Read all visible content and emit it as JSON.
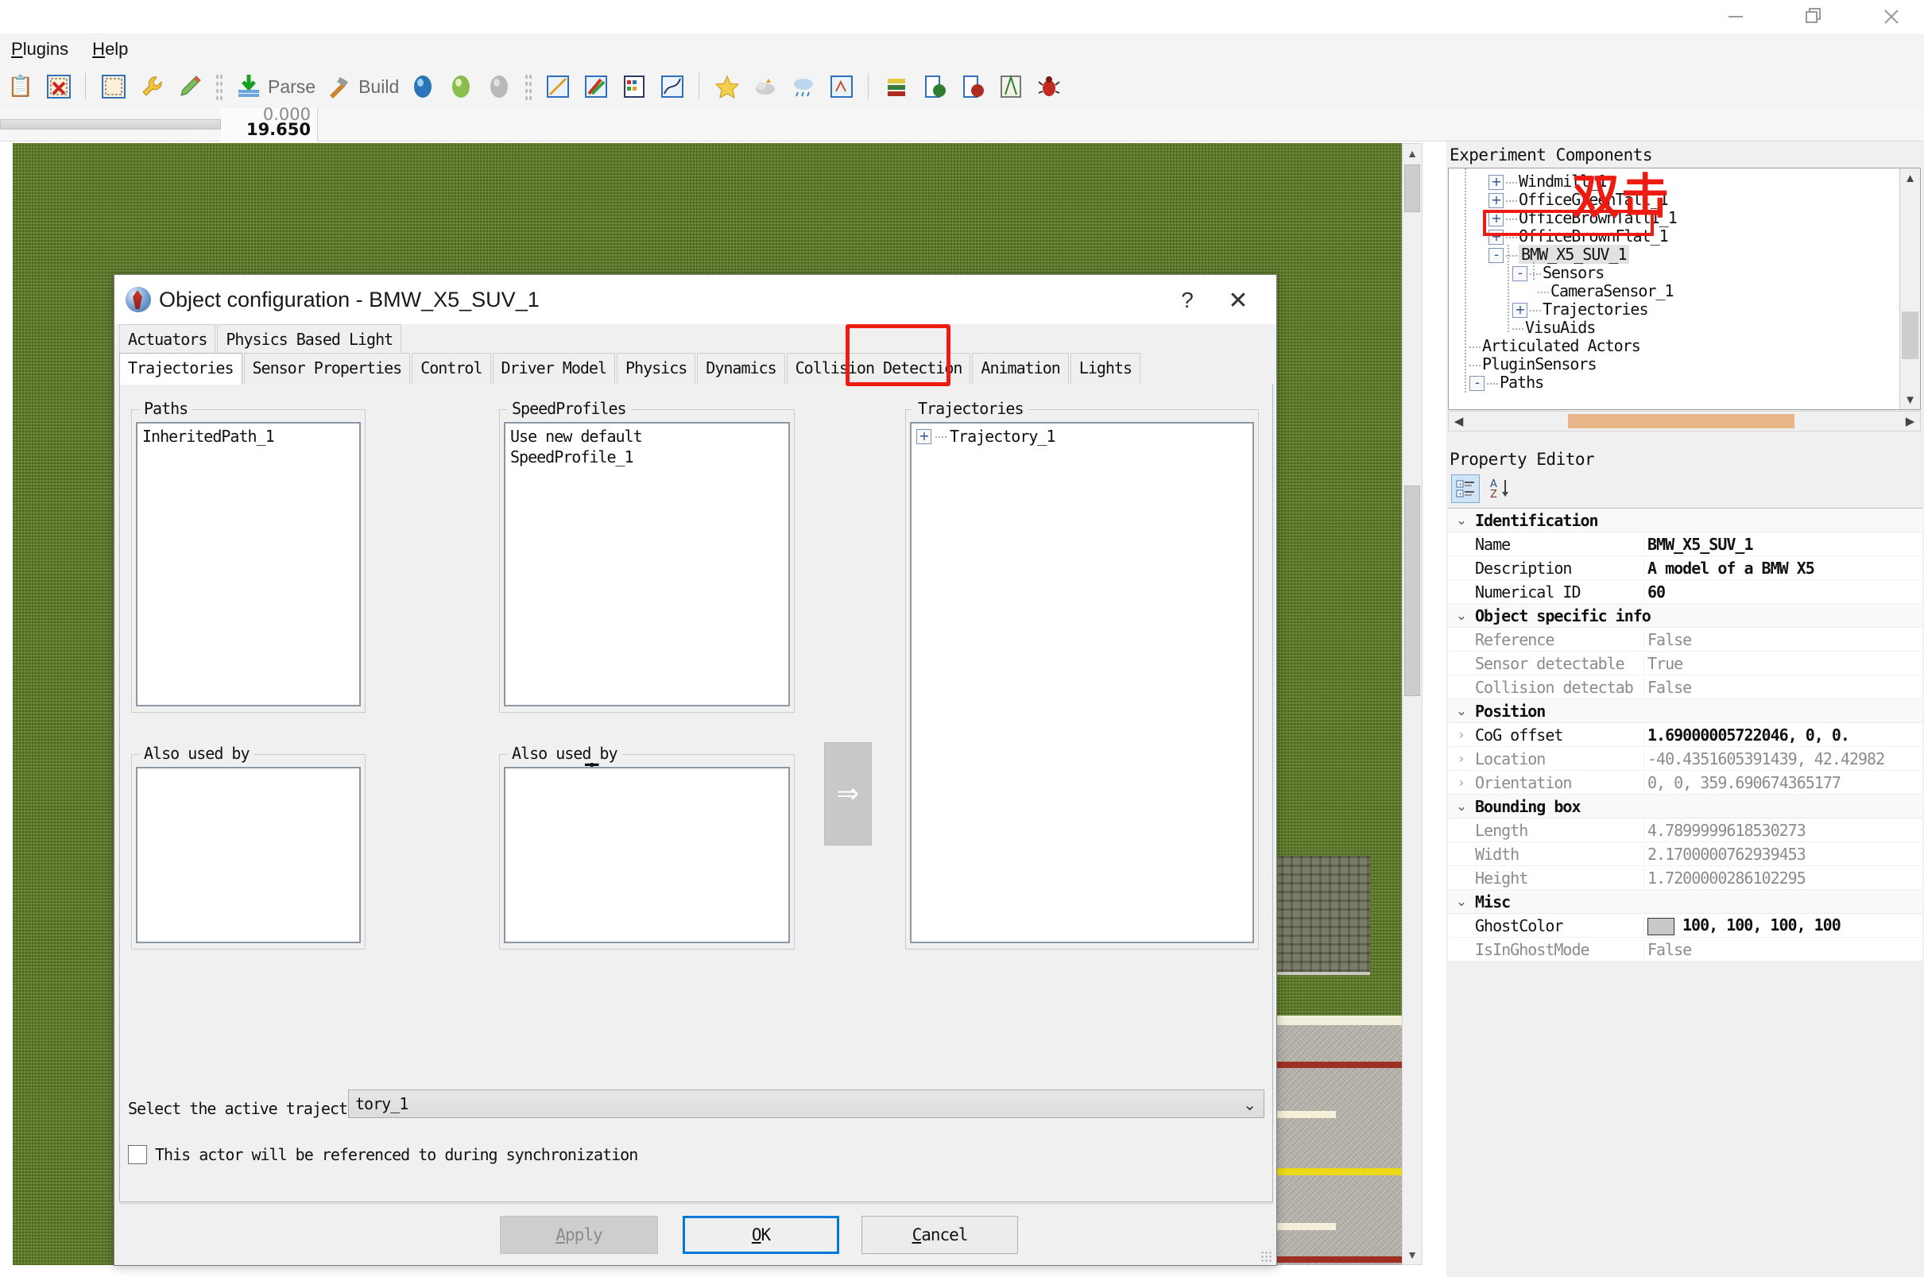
{
  "window": {
    "controls": {
      "minimize": "minimize-icon",
      "restore": "restore-icon",
      "close": "close-icon"
    }
  },
  "menubar": {
    "items": [
      {
        "label": "Plugins",
        "accel": "P"
      },
      {
        "label": "Help",
        "accel": "H"
      }
    ]
  },
  "toolbar": {
    "parse_label": "Parse",
    "build_label": "Build",
    "icons": [
      "clipboard-icon",
      "delete-selection-icon",
      "selection-icon",
      "wrench-icon",
      "pencil-icon",
      "parse-icon",
      "build-hammer-icon",
      "globe-blue-icon",
      "globe-green-icon",
      "globe-grey-icon",
      "measure-icon",
      "paint-tools-icon",
      "table-icon",
      "chart-icon",
      "star-icon",
      "fog-icon",
      "rain-icon",
      "snow-icon",
      "bar-chart-icon",
      "green-book-icon",
      "red-book-icon",
      "scenario-icon",
      "bug-icon"
    ]
  },
  "timestrip": {
    "time_top": "0.000",
    "time_bottom": "19.650"
  },
  "viewport": {
    "name": "3d-scene-viewport"
  },
  "experiment_components": {
    "title": "Experiment Components",
    "nodes": [
      {
        "label": "Windmill_1",
        "toggle": "+",
        "depth": 1,
        "selected": false
      },
      {
        "label": "OfficeGreenTall_1",
        "toggle": "+",
        "depth": 1,
        "selected": false
      },
      {
        "label": "OfficeBrownTall1_1",
        "toggle": "+",
        "depth": 1,
        "selected": false
      },
      {
        "label": "OfficeBrownFlat_1",
        "toggle": "+",
        "depth": 1,
        "selected": false
      },
      {
        "label": "BMW_X5_SUV_1",
        "toggle": "-",
        "depth": 1,
        "selected": true
      },
      {
        "label": "Sensors",
        "toggle": "-",
        "depth": 2,
        "selected": false
      },
      {
        "label": "CameraSensor_1",
        "toggle": "",
        "depth": 3,
        "selected": false
      },
      {
        "label": "Trajectories",
        "toggle": "+",
        "depth": 2,
        "selected": false
      },
      {
        "label": "VisuAids",
        "toggle": "",
        "depth": 2,
        "selected": false
      },
      {
        "label": "Articulated Actors",
        "toggle": "",
        "depth": 0,
        "selected": false
      },
      {
        "label": "PluginSensors",
        "toggle": "",
        "depth": 0,
        "selected": false
      },
      {
        "label": "Paths",
        "toggle": "-",
        "depth": 0,
        "selected": false
      }
    ],
    "annotation": "双击",
    "annotation_color": "#ee1b12"
  },
  "property_editor": {
    "title": "Property Editor",
    "toolbar": {
      "categorized": "categorized-view-icon",
      "alphabetical": "sort-az-icon"
    },
    "groups": [
      {
        "name": "Identification",
        "rows": [
          {
            "name": "Name",
            "value": "BMW_X5_SUV_1",
            "bold": true,
            "expandable": false
          },
          {
            "name": "Description",
            "value": "A model of a BMW X5",
            "bold": true,
            "expandable": false
          },
          {
            "name": "Numerical ID",
            "value": "60",
            "bold": true,
            "expandable": false
          }
        ]
      },
      {
        "name": "Object specific info",
        "rows": [
          {
            "name": "Reference",
            "value": "False",
            "bold": false,
            "expandable": false
          },
          {
            "name": "Sensor detectable",
            "value": "True",
            "bold": false,
            "expandable": false
          },
          {
            "name": "Collision detectab",
            "value": "False",
            "bold": false,
            "expandable": false
          }
        ]
      },
      {
        "name": "Position",
        "rows": [
          {
            "name": "CoG offset",
            "value": "1.69000005722046, 0, 0.",
            "bold": true,
            "expandable": true
          },
          {
            "name": "Location",
            "value": "-40.4351605391439, 42.42982",
            "bold": false,
            "expandable": true
          },
          {
            "name": "Orientation",
            "value": "0, 0, 359.690674365177",
            "bold": false,
            "expandable": true
          }
        ]
      },
      {
        "name": "Bounding box",
        "rows": [
          {
            "name": "Length",
            "value": "4.7899999618530273",
            "bold": false,
            "expandable": false
          },
          {
            "name": "Width",
            "value": "2.1700000762939453",
            "bold": false,
            "expandable": false
          },
          {
            "name": "Height",
            "value": "1.7200000286102295",
            "bold": false,
            "expandable": false
          }
        ]
      },
      {
        "name": "Misc",
        "rows": [
          {
            "name": "GhostColor",
            "value": "100, 100, 100, 100",
            "bold": true,
            "expandable": false,
            "swatch": "#c8c8c8"
          },
          {
            "name": "IsInGhostMode",
            "value": "False",
            "bold": false,
            "expandable": false
          }
        ]
      }
    ]
  },
  "dialog": {
    "title": "Object configuration - BMW_X5_SUV_1",
    "help_label": "?",
    "close_label": "✕",
    "tabs_row1": [
      {
        "label": "Actuators",
        "active": false
      },
      {
        "label": "Physics Based Light",
        "active": false
      }
    ],
    "tabs_row2": [
      {
        "label": "Trajectories",
        "active": true
      },
      {
        "label": "Sensor Properties",
        "active": false
      },
      {
        "label": "Control",
        "active": false
      },
      {
        "label": "Driver Model",
        "active": false
      },
      {
        "label": "Physics",
        "active": false
      },
      {
        "label": "Dynamics",
        "active": false,
        "highlighted": true
      },
      {
        "label": "Collision Detection",
        "active": false
      },
      {
        "label": "Animation",
        "active": false
      },
      {
        "label": "Lights",
        "active": false
      }
    ],
    "highlight_color": "#ee1b12",
    "paths": {
      "legend": "Paths",
      "items": [
        "InheritedPath_1"
      ]
    },
    "speedprofiles": {
      "legend": "SpeedProfiles",
      "items": [
        "Use new default",
        "SpeedProfile_1"
      ]
    },
    "trajectories": {
      "legend": "Trajectories",
      "items": [
        {
          "label": "Trajectory_1",
          "toggle": "+"
        }
      ]
    },
    "also_used_by_left": {
      "legend": "Also used by",
      "items": []
    },
    "also_used_by_right": {
      "legend": "Also used by",
      "items": []
    },
    "add_button": "+",
    "transfer_button": "⇒",
    "select_label": "Select the active trajectory:",
    "select_value": "tory_1",
    "checkbox": {
      "checked": false,
      "label": "This actor will be referenced to during synchronization"
    },
    "buttons": {
      "apply": "Apply",
      "apply_accel": "A",
      "ok": "OK",
      "ok_accel": "O",
      "cancel": "Cancel",
      "cancel_accel": "C"
    }
  }
}
